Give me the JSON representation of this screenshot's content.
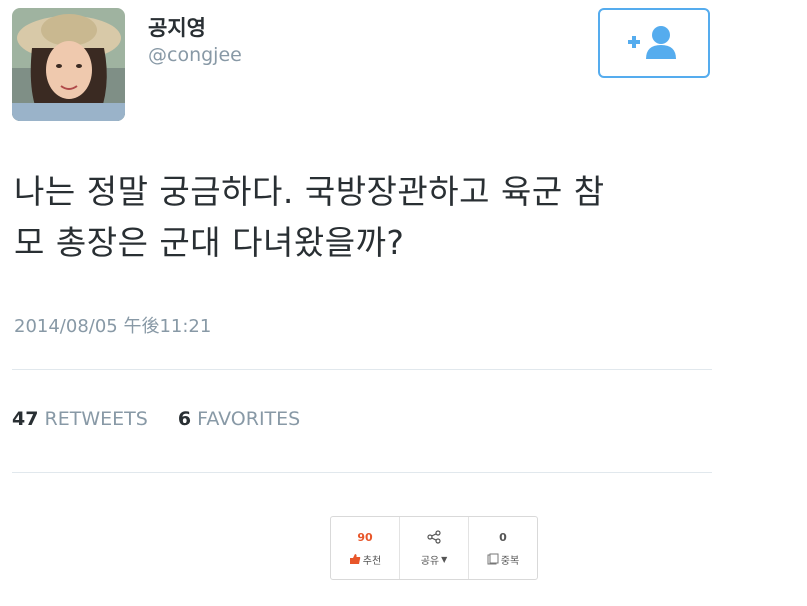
{
  "profile": {
    "display_name": "공지영",
    "handle": "@congjee"
  },
  "follow_button": {
    "icon": "add-user-icon",
    "color": "#55acee"
  },
  "tweet": {
    "text_line1": "나는 정말 궁금하다. 국방장관하고 육군 참",
    "text_line2": "모 총장은 군대 다녀왔을까?",
    "timestamp": "2014/08/05 午後11:21"
  },
  "stats": {
    "retweets_count": "47",
    "retweets_label": "RETWEETS",
    "favorites_count": "6",
    "favorites_label": "FAVORITES"
  },
  "social_bar": {
    "recommend_count": "90",
    "recommend_label": "추천",
    "share_label": "공유",
    "dup_count": "0",
    "dup_label": "중복",
    "recommend_color": "#e8562a"
  }
}
